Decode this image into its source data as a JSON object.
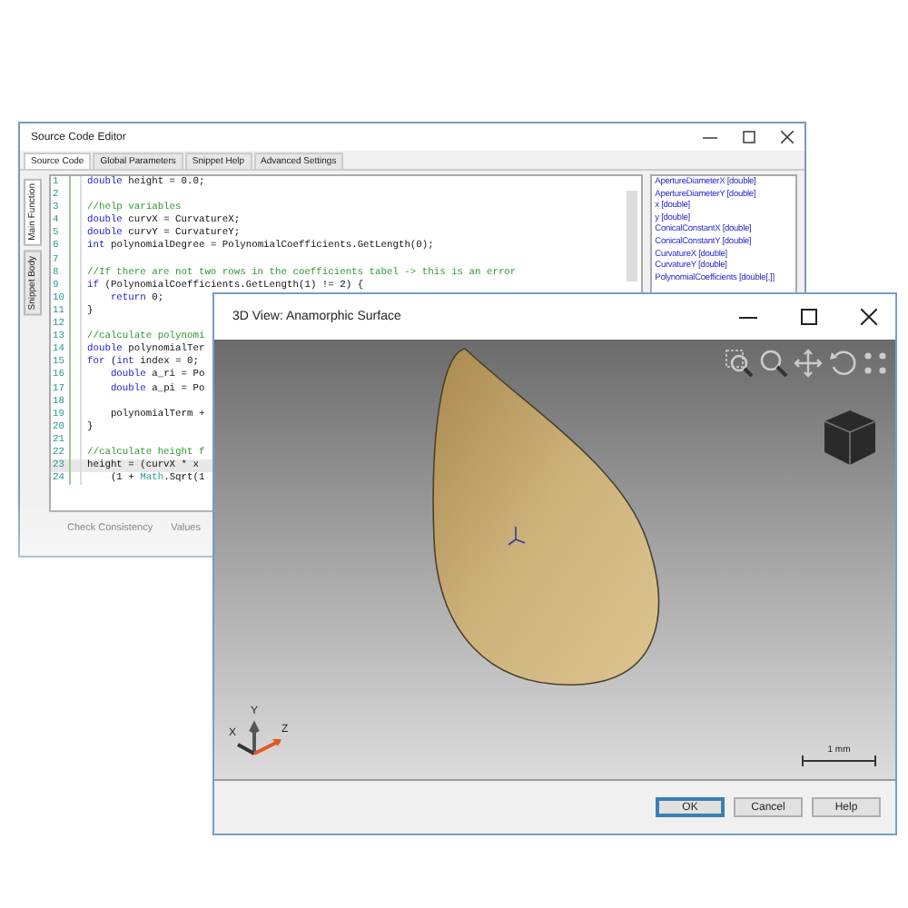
{
  "editor_window": {
    "title": "Source Code Editor",
    "tabs": [
      {
        "label": "Source Code",
        "selected": true
      },
      {
        "label": "Global Parameters",
        "selected": false
      },
      {
        "label": "Snippet Help",
        "selected": false
      },
      {
        "label": "Advanced Settings",
        "selected": false
      }
    ],
    "side_tabs": [
      {
        "label": "Main Function",
        "selected": true
      },
      {
        "label": "Snippet Body",
        "selected": false
      }
    ],
    "code_lines": [
      {
        "number": "1",
        "current": false,
        "segments": [
          {
            "kind": "keyword",
            "text": "double"
          },
          {
            "kind": "plain",
            "text": " height = 0.0;"
          }
        ]
      },
      {
        "number": "2",
        "current": false
      },
      {
        "number": "3",
        "current": false,
        "segments": [
          {
            "kind": "comment",
            "text": "//help variables"
          }
        ]
      },
      {
        "number": "4",
        "current": false,
        "segments": [
          {
            "kind": "keyword",
            "text": "double"
          },
          {
            "kind": "plain",
            "text": " curvX = CurvatureX;"
          }
        ]
      },
      {
        "number": "5",
        "current": false,
        "segments": [
          {
            "kind": "keyword",
            "text": "double"
          },
          {
            "kind": "plain",
            "text": " curvY = CurvatureY;"
          }
        ]
      },
      {
        "number": "6",
        "current": false,
        "segments": [
          {
            "kind": "keyword",
            "text": "int"
          },
          {
            "kind": "plain",
            "text": " polynomialDegree = PolynomialCoefficients.GetLength(0);"
          }
        ]
      },
      {
        "number": "7",
        "current": false
      },
      {
        "number": "8",
        "current": false,
        "segments": [
          {
            "kind": "comment",
            "text": "//If there are not two rows in the coefficients tabel -> this is an error"
          }
        ]
      },
      {
        "number": "9",
        "current": false,
        "segments": [
          {
            "kind": "keyword",
            "text": "if"
          },
          {
            "kind": "plain",
            "text": " (PolynomialCoefficients.GetLength(1) != 2) {"
          }
        ]
      },
      {
        "number": "10",
        "current": false,
        "segments": [
          {
            "kind": "keyword",
            "text": "    return"
          },
          {
            "kind": "plain",
            "text": " 0;"
          }
        ]
      },
      {
        "number": "11",
        "current": false,
        "segments": [
          {
            "kind": "plain",
            "text": "}"
          }
        ]
      },
      {
        "number": "12",
        "current": false
      },
      {
        "number": "13",
        "current": false,
        "segments": [
          {
            "kind": "comment",
            "text": "//calculate polynomi"
          }
        ]
      },
      {
        "number": "14",
        "current": false,
        "segments": [
          {
            "kind": "keyword",
            "text": "double"
          },
          {
            "kind": "plain",
            "text": " polynomialTer"
          }
        ]
      },
      {
        "number": "15",
        "current": false,
        "segments": [
          {
            "kind": "keyword",
            "text": "for"
          },
          {
            "kind": "plain",
            "text": " ("
          },
          {
            "kind": "keyword",
            "text": "int"
          },
          {
            "kind": "plain",
            "text": " index = 0;"
          }
        ]
      },
      {
        "number": "16",
        "current": false,
        "segments": [
          {
            "kind": "keyword",
            "text": "    double"
          },
          {
            "kind": "plain",
            "text": " a_ri = Po"
          }
        ]
      },
      {
        "number": "17",
        "current": false,
        "segments": [
          {
            "kind": "keyword",
            "text": "    double"
          },
          {
            "kind": "plain",
            "text": " a_pi = Po"
          }
        ]
      },
      {
        "number": "18",
        "current": false
      },
      {
        "number": "19",
        "current": false,
        "segments": [
          {
            "kind": "plain",
            "text": "    polynomialTerm +"
          }
        ]
      },
      {
        "number": "20",
        "current": false,
        "segments": [
          {
            "kind": "plain",
            "text": "}"
          }
        ]
      },
      {
        "number": "21",
        "current": false
      },
      {
        "number": "22",
        "current": false,
        "segments": [
          {
            "kind": "comment",
            "text": "//calculate height f"
          }
        ]
      },
      {
        "number": "23",
        "current": true,
        "segments": [
          {
            "kind": "plain",
            "text": "height = (curvX * x"
          }
        ]
      },
      {
        "number": "24",
        "current": false,
        "segments": [
          {
            "kind": "plain",
            "text": "    (1 + "
          },
          {
            "kind": "type",
            "text": "Math"
          },
          {
            "kind": "plain",
            "text": ".Sqrt(1"
          }
        ]
      }
    ],
    "parameters": [
      "ApertureDiameterX [double]",
      "ApertureDiameterY [double]",
      "x [double]",
      "y [double]",
      "ConicalConstantX [double]",
      "ConicalConstantY [double]",
      "CurvatureX [double]",
      "CurvatureY [double]",
      "PolynomialCoefficients [double[,]]"
    ],
    "toolbar": [
      "Check Consistency",
      "Values"
    ]
  },
  "view_window": {
    "title": "3D View: Anamorphic Surface",
    "axes": [
      "X",
      "Y",
      "Z"
    ],
    "scale_label": "1 mm",
    "buttons": [
      {
        "label": "OK",
        "default": true
      },
      {
        "label": "Cancel",
        "default": false
      },
      {
        "label": "Help",
        "default": false
      }
    ]
  }
}
